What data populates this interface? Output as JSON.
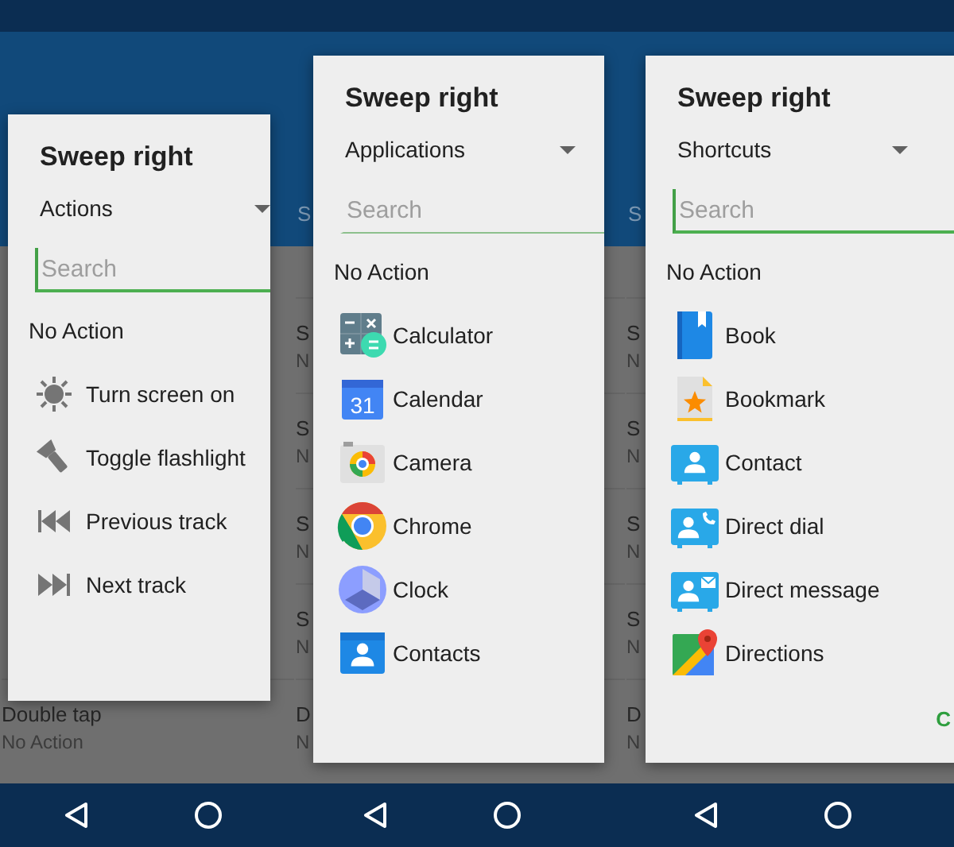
{
  "phones": [
    {
      "rows": [
        {
          "title": "Double tap",
          "subtitle": "No Action"
        }
      ],
      "dialog": {
        "title": "Sweep right",
        "dropdown": "Actions",
        "search": {
          "placeholder": "Search",
          "focused": true
        },
        "no_action": "No Action",
        "items": [
          {
            "kind": "action",
            "label": "Turn screen on"
          },
          {
            "kind": "action",
            "label": "Toggle flashlight"
          },
          {
            "kind": "action",
            "label": "Previous track"
          },
          {
            "kind": "action",
            "label": "Next track"
          }
        ]
      }
    },
    {
      "header": {
        "subtitle": "S"
      },
      "rows": [
        {
          "title": "S",
          "subtitle": "N"
        },
        {
          "title": "S",
          "subtitle": "N"
        },
        {
          "title": "S",
          "subtitle": "N"
        },
        {
          "title": "S",
          "subtitle": "N"
        },
        {
          "title": "D",
          "subtitle": "N"
        }
      ],
      "dialog": {
        "title": "Sweep right",
        "dropdown": "Applications",
        "search": {
          "placeholder": "Search",
          "focused": false
        },
        "no_action": "No Action",
        "items": [
          {
            "kind": "app",
            "label": "Calculator"
          },
          {
            "kind": "app",
            "label": "Calendar",
            "icon_text": "31"
          },
          {
            "kind": "app",
            "label": "Camera"
          },
          {
            "kind": "app",
            "label": "Chrome"
          },
          {
            "kind": "app",
            "label": "Clock"
          },
          {
            "kind": "app",
            "label": "Contacts"
          }
        ]
      }
    },
    {
      "header": {
        "subtitle": "S"
      },
      "rows": [
        {
          "title": "S",
          "subtitle": "N"
        },
        {
          "title": "S",
          "subtitle": "N"
        },
        {
          "title": "S",
          "subtitle": "N"
        },
        {
          "title": "S",
          "subtitle": "N"
        },
        {
          "title": "D",
          "subtitle": "N"
        }
      ],
      "dialog": {
        "title": "Sweep right",
        "dropdown": "Shortcuts",
        "search": {
          "placeholder": "Search",
          "focused": true
        },
        "no_action": "No Action",
        "items": [
          {
            "kind": "shortcut",
            "label": "Book"
          },
          {
            "kind": "shortcut",
            "label": "Bookmark"
          },
          {
            "kind": "shortcut",
            "label": "Contact"
          },
          {
            "kind": "shortcut",
            "label": "Direct dial"
          },
          {
            "kind": "shortcut",
            "label": "Direct message"
          },
          {
            "kind": "shortcut",
            "label": "Directions"
          }
        ],
        "buttons": [
          "C"
        ]
      }
    }
  ]
}
